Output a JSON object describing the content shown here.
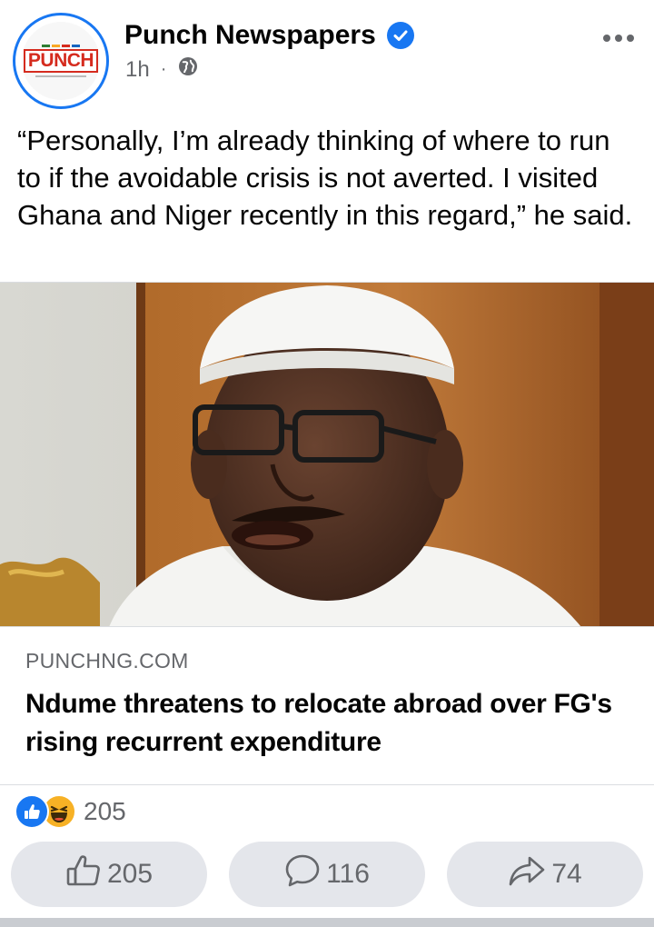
{
  "post": {
    "page_name": "Punch Newspapers",
    "logo_text": "PUNCH",
    "time": "1h",
    "separator": "·",
    "audience_icon": "globe-icon",
    "verified_icon": "verified-badge-icon",
    "more_icon": "more-options-icon",
    "text": "“Personally, I’m already thinking of where to run to if the avoidable crisis is not averted. I visited Ghana and Niger recently in this regard,” he said."
  },
  "link": {
    "domain": "PUNCHNG.COM",
    "headline": "Ndume threatens to relocate abroad over FG's rising recurrent expenditure"
  },
  "reactions": {
    "icons": [
      "like-reaction-icon",
      "haha-reaction-icon"
    ],
    "total": "205"
  },
  "actions": {
    "like_count": "205",
    "comment_count": "116",
    "share_count": "74"
  },
  "colors": {
    "accent": "#1877f2",
    "secondary_text": "#65676b",
    "button_bg": "#e4e6eb",
    "logo_red": "#d52b1e"
  }
}
